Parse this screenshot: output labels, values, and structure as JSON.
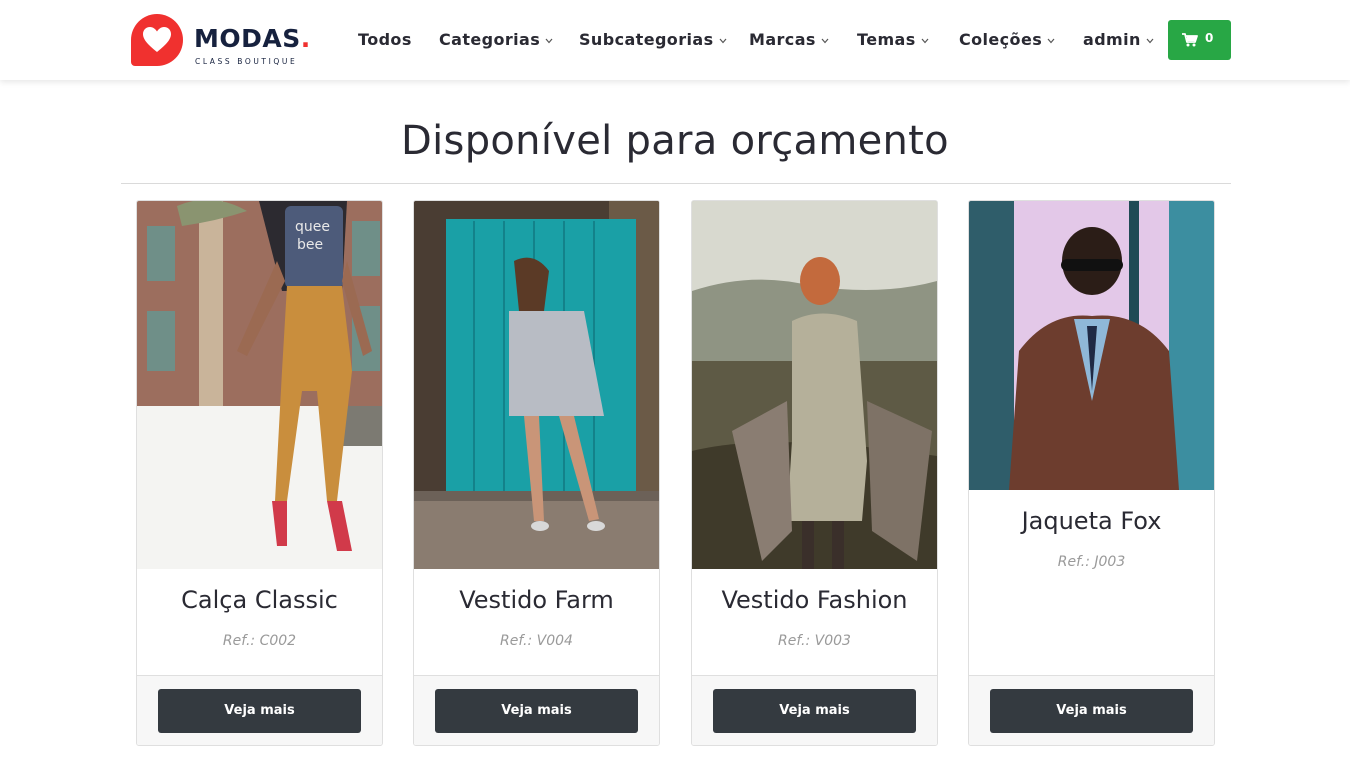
{
  "brand": {
    "name": "MODAS",
    "dot": ".",
    "tagline": "CLASS BOUTIQUE",
    "accent_color": "#f0312f",
    "text_color": "#16213e"
  },
  "nav": {
    "items": [
      {
        "label": "Todos",
        "has_dropdown": false
      },
      {
        "label": "Categorias",
        "has_dropdown": true
      },
      {
        "label": "Subcategorias",
        "has_dropdown": true
      },
      {
        "label": "Marcas",
        "has_dropdown": true
      },
      {
        "label": "Temas",
        "has_dropdown": true
      },
      {
        "label": "Coleções",
        "has_dropdown": true
      },
      {
        "label": "admin",
        "has_dropdown": true
      }
    ],
    "cart": {
      "icon": "cart-icon",
      "count": "0",
      "color": "#28a745"
    }
  },
  "section": {
    "title": "Disponível para orçamento"
  },
  "products": [
    {
      "name": "Calça Classic",
      "ref": "Ref.: C002",
      "button": "Veja mais",
      "image": "woman-jeans-photo"
    },
    {
      "name": "Vestido Farm",
      "ref": "Ref.: V004",
      "button": "Veja mais",
      "image": "woman-striped-dress-photo"
    },
    {
      "name": "Vestido Fashion",
      "ref": "Ref.: V003",
      "button": "Veja mais",
      "image": "woman-beige-dress-photo"
    },
    {
      "name": "Jaqueta Fox",
      "ref": "Ref.: J003",
      "button": "Veja mais",
      "image": "man-leather-jacket-photo"
    }
  ]
}
